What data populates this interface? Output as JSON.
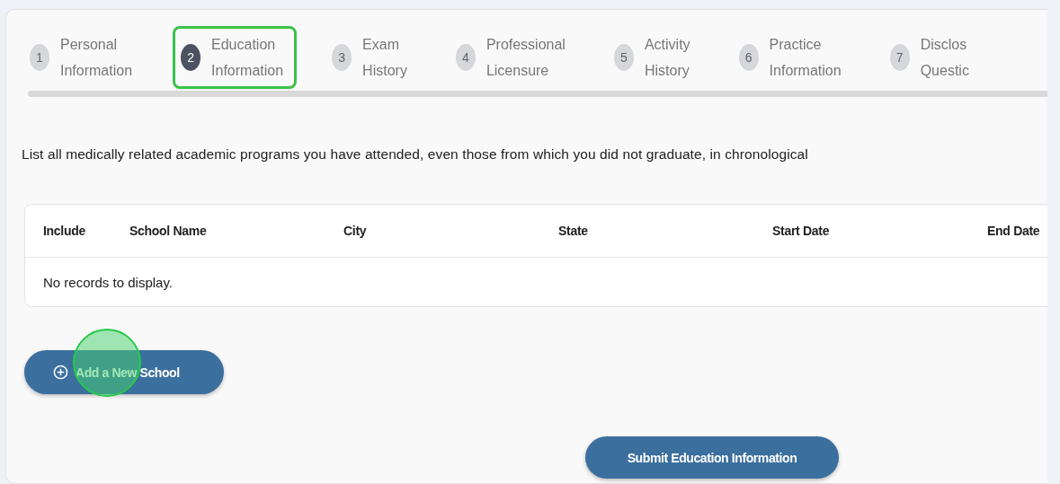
{
  "steps": [
    {
      "number": "1",
      "lines": [
        "Personal",
        "Information"
      ],
      "selected": false
    },
    {
      "number": "2",
      "lines": [
        "Education",
        "Information"
      ],
      "selected": true
    },
    {
      "number": "3",
      "lines": [
        "Exam",
        "History"
      ],
      "selected": false
    },
    {
      "number": "4",
      "lines": [
        "Professional",
        "Licensure"
      ],
      "selected": false
    },
    {
      "number": "5",
      "lines": [
        "Activity",
        "History"
      ],
      "selected": false
    },
    {
      "number": "6",
      "lines": [
        "Practice",
        "Information"
      ],
      "selected": false
    },
    {
      "number": "7",
      "lines": [
        "Disclos",
        "Questic"
      ],
      "selected": false
    }
  ],
  "instructions": "List all medically related academic programs you have attended, even those from which you did not graduate, in chronological",
  "table": {
    "columns": [
      "Include",
      "School Name",
      "City",
      "State",
      "Start Date",
      "End Date"
    ],
    "empty_message": "No records to display."
  },
  "add_button": {
    "label": "Add a New School",
    "click_marker": true
  },
  "submit_button": {
    "label": "Submit Education Information"
  }
}
